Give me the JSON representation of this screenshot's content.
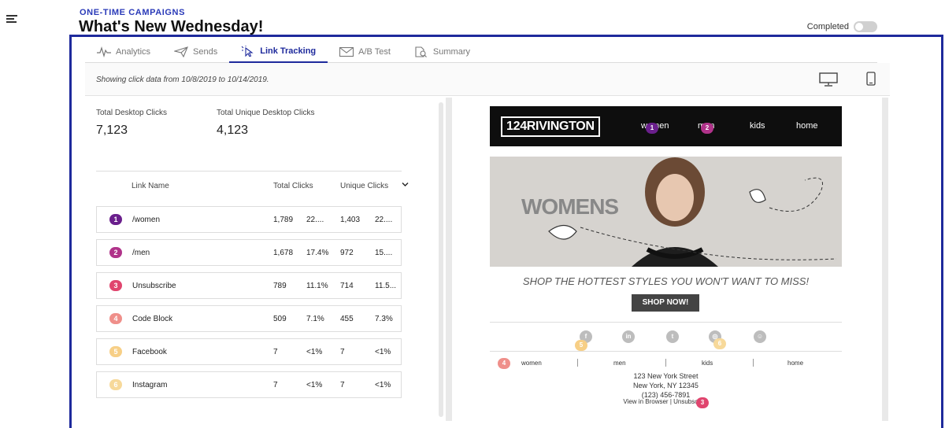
{
  "header": {
    "eyebrow": "ONE-TIME CAMPAIGNS",
    "title": "What's New Wednesday!",
    "completed_label": "Completed"
  },
  "tabs": [
    {
      "label": "Analytics",
      "icon": "pulse-icon"
    },
    {
      "label": "Sends",
      "icon": "paper-plane-icon"
    },
    {
      "label": "Link Tracking",
      "icon": "cursor-click-icon",
      "active": true
    },
    {
      "label": "A/B Test",
      "icon": "envelope-icon"
    },
    {
      "label": "Summary",
      "icon": "document-search-icon"
    }
  ],
  "range_text": "Showing click data from 10/8/2019 to 10/14/2019.",
  "stats": {
    "desktop_clicks_label": "Total Desktop Clicks",
    "desktop_clicks_value": "7,123",
    "unique_clicks_label": "Total Unique Desktop Clicks",
    "unique_clicks_value": "4,123"
  },
  "table": {
    "headers": {
      "link_name": "Link Name",
      "total_clicks": "Total Clicks",
      "unique_clicks": "Unique Clicks"
    },
    "rows": [
      {
        "num": "1",
        "name": "/women",
        "total": "1,789",
        "total_pct": "22....",
        "unique": "1,403",
        "unique_pct": "22....",
        "color": "#6a1f8c"
      },
      {
        "num": "2",
        "name": "/men",
        "total": "1,678",
        "total_pct": "17.4%",
        "unique": "972",
        "unique_pct": "15....",
        "color": "#b0338a"
      },
      {
        "num": "3",
        "name": "Unsubscribe",
        "total": "789",
        "total_pct": "11.1%",
        "unique": "714",
        "unique_pct": "11.5...",
        "color": "#e0456e"
      },
      {
        "num": "4",
        "name": "Code Block",
        "total": "509",
        "total_pct": "7.1%",
        "unique": "455",
        "unique_pct": "7.3%",
        "color": "#ef8f8a"
      },
      {
        "num": "5",
        "name": "Facebook",
        "total": "7",
        "total_pct": "<1%",
        "unique": "7",
        "unique_pct": "<1%",
        "color": "#f7cf86"
      },
      {
        "num": "6",
        "name": "Instagram",
        "total": "7",
        "total_pct": "<1%",
        "unique": "7",
        "unique_pct": "<1%",
        "color": "#f7d99a"
      }
    ]
  },
  "email": {
    "logo": "124RIVINGTON",
    "nav": [
      "women",
      "men",
      "kids",
      "home"
    ],
    "hero_text": "WOMENS",
    "tagline": "SHOP THE HOTTEST STYLES YOU WON'T WANT TO MISS!",
    "cta": "SHOP NOW!",
    "footer_nav": [
      "women",
      "men",
      "kids",
      "home"
    ],
    "address_line1": "123 New York Street",
    "address_line2": "New York, NY 12345",
    "phone": "(123) 456-7891",
    "view_links": "View in Browser | Unsubscribe"
  }
}
